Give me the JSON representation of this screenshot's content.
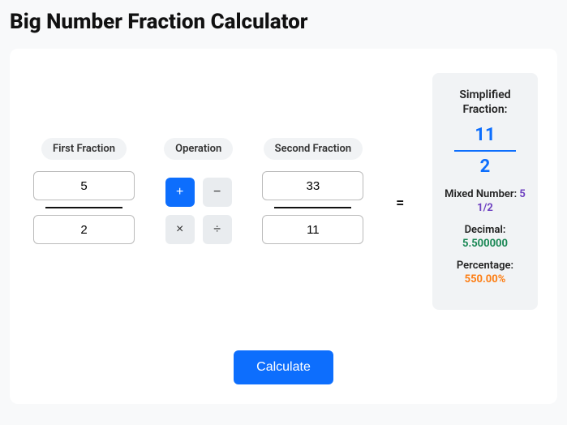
{
  "title": "Big Number Fraction Calculator",
  "fraction1": {
    "label": "First Fraction",
    "numerator": "5",
    "denominator": "2"
  },
  "operation": {
    "label": "Operation",
    "add": "+",
    "subtract": "−",
    "multiply": "×",
    "divide": "÷",
    "active": "add"
  },
  "fraction2": {
    "label": "Second Fraction",
    "numerator": "33",
    "denominator": "11"
  },
  "equals": "=",
  "result": {
    "simplified_label": "Simplified Fraction:",
    "numerator": "11",
    "denominator": "2",
    "mixed_label": "Mixed Number: ",
    "mixed_value": "5 1/2",
    "decimal_label": "Decimal: ",
    "decimal_value": "5.500000",
    "percent_label": "Percentage: ",
    "percent_value": "550.00%"
  },
  "calculate_label": "Calculate"
}
